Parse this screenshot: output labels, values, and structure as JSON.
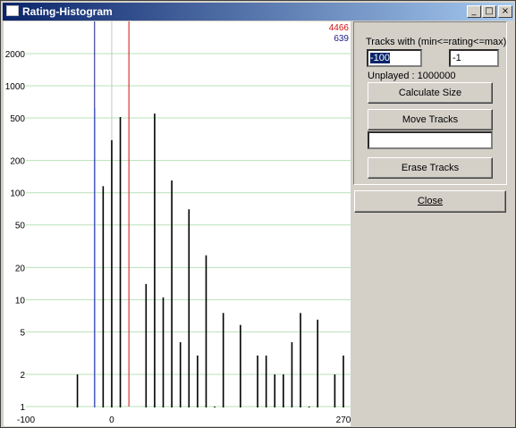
{
  "window": {
    "title": "Rating-Histogram",
    "minimize_glyph": "_",
    "maximize_glyph": "□",
    "close_glyph": "×"
  },
  "panel": {
    "range_label": "Tracks with (min<=rating<=max)",
    "min_value": "-100",
    "max_value": "-1",
    "unplayed_text": "Unplayed : 1000000",
    "calculate_label": "Calculate Size",
    "move_label": "Move Tracks",
    "move_target_value": "",
    "erase_label": "Erase Tracks",
    "close_label": "Close"
  },
  "chart_data": {
    "type": "bar",
    "y_scale": "log",
    "ylim": [
      1,
      4000
    ],
    "xlim": [
      -100,
      270
    ],
    "x_ticks": [
      "-100",
      "0",
      "270"
    ],
    "y_ticks": [
      {
        "label": "2000",
        "value": 2000
      },
      {
        "label": "1000",
        "value": 1000
      },
      {
        "label": "500",
        "value": 500
      },
      {
        "label": "200",
        "value": 200
      },
      {
        "label": "100",
        "value": 100
      },
      {
        "label": "50",
        "value": 50
      },
      {
        "label": "20",
        "value": 20
      },
      {
        "label": "10",
        "value": 10
      },
      {
        "label": "5",
        "value": 5
      },
      {
        "label": "2",
        "value": 2
      },
      {
        "label": "1",
        "value": 1
      }
    ],
    "markers": [
      {
        "label": "4466",
        "x": 20,
        "color": "#d01010"
      },
      {
        "label": "639",
        "x": -20,
        "color": "#1a1a8c"
      }
    ],
    "bars": [
      {
        "x": -40,
        "value": 2
      },
      {
        "x": -20,
        "value": 620,
        "color": "#5060c0"
      },
      {
        "x": -10,
        "value": 115
      },
      {
        "x": 0,
        "value": 310
      },
      {
        "x": 10,
        "value": 510
      },
      {
        "x": 40,
        "value": 14
      },
      {
        "x": 50,
        "value": 550
      },
      {
        "x": 60,
        "value": 10.5
      },
      {
        "x": 70,
        "value": 130
      },
      {
        "x": 80,
        "value": 4
      },
      {
        "x": 90,
        "value": 70
      },
      {
        "x": 100,
        "value": 3
      },
      {
        "x": 110,
        "value": 26
      },
      {
        "x": 120,
        "value": 1
      },
      {
        "x": 130,
        "value": 7.5
      },
      {
        "x": 150,
        "value": 5.8
      },
      {
        "x": 170,
        "value": 3
      },
      {
        "x": 180,
        "value": 3
      },
      {
        "x": 190,
        "value": 2
      },
      {
        "x": 200,
        "value": 2
      },
      {
        "x": 210,
        "value": 4
      },
      {
        "x": 220,
        "value": 7.5
      },
      {
        "x": 230,
        "value": 1
      },
      {
        "x": 240,
        "value": 6.5
      },
      {
        "x": 260,
        "value": 2
      },
      {
        "x": 270,
        "value": 3
      }
    ],
    "grid": true
  }
}
